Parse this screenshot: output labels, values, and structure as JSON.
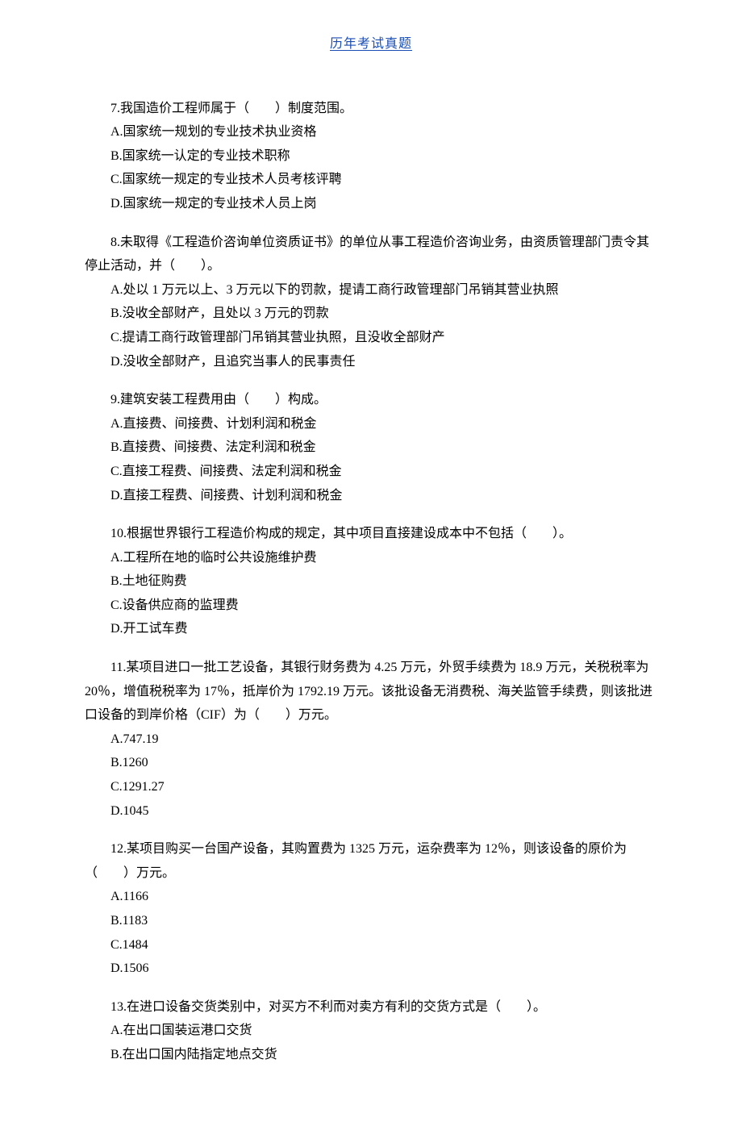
{
  "header": "历年考试真题",
  "questions": [
    {
      "stem": "7.我国造价工程师属于（　　）制度范围。",
      "options": [
        "A.国家统一规划的专业技术执业资格",
        "B.国家统一认定的专业技术职称",
        "C.国家统一规定的专业技术人员考核评聘",
        "D.国家统一规定的专业技术人员上岗"
      ]
    },
    {
      "stem": "8.未取得《工程造价咨询单位资质证书》的单位从事工程造价咨询业务，由资质管理部门责令其停止活动，并（　　）。",
      "options": [
        "A.处以 1 万元以上、3 万元以下的罚款，提请工商行政管理部门吊销其营业执照",
        "B.没收全部财产，且处以 3 万元的罚款",
        "C.提请工商行政管理部门吊销其营业执照，且没收全部财产",
        "D.没收全部财产，且追究当事人的民事责任"
      ]
    },
    {
      "stem": "9.建筑安装工程费用由（　　）构成。",
      "options": [
        "A.直接费、间接费、计划利润和税金",
        "B.直接费、间接费、法定利润和税金",
        "C.直接工程费、间接费、法定利润和税金",
        "D.直接工程费、间接费、计划利润和税金"
      ]
    },
    {
      "stem": "10.根据世界银行工程造价构成的规定，其中项目直接建设成本中不包括（　　）。",
      "options": [
        "A.工程所在地的临时公共设施维护费",
        "B.土地征购费",
        "C.设备供应商的监理费",
        "D.开工试车费"
      ]
    },
    {
      "stem": "11.某项目进口一批工艺设备，其银行财务费为 4.25 万元，外贸手续费为 18.9 万元，关税税率为 20％，增值税税率为 17％，抵岸价为 1792.19 万元。该批设备无消费税、海关监管手续费，则该批进口设备的到岸价格（CIF）为（　　）万元。",
      "options": [
        "A.747.19",
        "B.1260",
        "C.1291.27",
        "D.1045"
      ]
    },
    {
      "stem": "12.某项目购买一台国产设备，其购置费为 1325 万元，运杂费率为 12％，则该设备的原价为（　　）万元。",
      "options": [
        "A.1166",
        "B.1183",
        "C.1484",
        "D.1506"
      ]
    },
    {
      "stem": "13.在进口设备交货类别中，对买方不利而对卖方有利的交货方式是（　　）。",
      "options": [
        "A.在出口国装运港口交货",
        "B.在出口国内陆指定地点交货"
      ]
    }
  ]
}
